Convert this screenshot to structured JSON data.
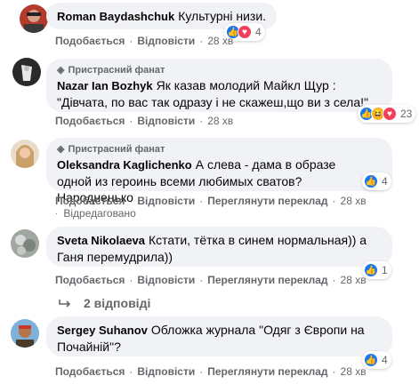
{
  "comments": [
    {
      "author": "Roman Baydashchuk",
      "badge": "",
      "text": "Культурні низи.",
      "like": "Подобається",
      "reply": "Відповісти",
      "time": "28 хв",
      "reaction_count": "4"
    },
    {
      "author": "Nazar Ian Bozhyk",
      "badge": "Пристрасний фанат",
      "text": "Як казав молодий Майкл Щур : \"Дівчата, по вас так одразу і не скажеш,що ви з села!\"",
      "like": "Подобається",
      "reply": "Відповісти",
      "time": "28 хв",
      "reaction_count": "23"
    },
    {
      "author": "Oleksandra Kaglichenko",
      "badge": "Пристрасний фанат",
      "text": "А слева - дама в образе одной из героинь всеми любимых сватов? Народненько",
      "like": "Подобається",
      "reply": "Відповісти",
      "translate": "Переглянути переклад",
      "time": "28 хв",
      "edited": "Відредаговано",
      "reaction_count": "4"
    },
    {
      "author": "Sveta Nikolaeva",
      "badge": "",
      "text": "Кстати, тётка в синем нормальная)) а Ганя перемудрила))",
      "like": "Подобається",
      "reply": "Відповісти",
      "translate": "Переглянути переклад",
      "time": "28 хв",
      "reaction_count": "1",
      "replies_label": "2 відповіді"
    },
    {
      "author": "Sergey Suhanov",
      "badge": "",
      "text": "Обложка журнала \"Одяг з Європи на Почайній\"?",
      "like": "Подобається",
      "reply": "Відповісти",
      "translate": "Переглянути переклад",
      "time": "28 хв",
      "reaction_count": "4"
    }
  ],
  "icons": {
    "badge": "diamond-icon",
    "like": "like-icon",
    "love": "love-icon",
    "haha": "haha-icon",
    "reply_arrow": "reply-arrow-icon"
  },
  "colors": {
    "bubble": "#f0f2f5",
    "meta": "#65676b",
    "like": "#1877f2",
    "love": "#f33e58",
    "haha": "#f7b125"
  }
}
